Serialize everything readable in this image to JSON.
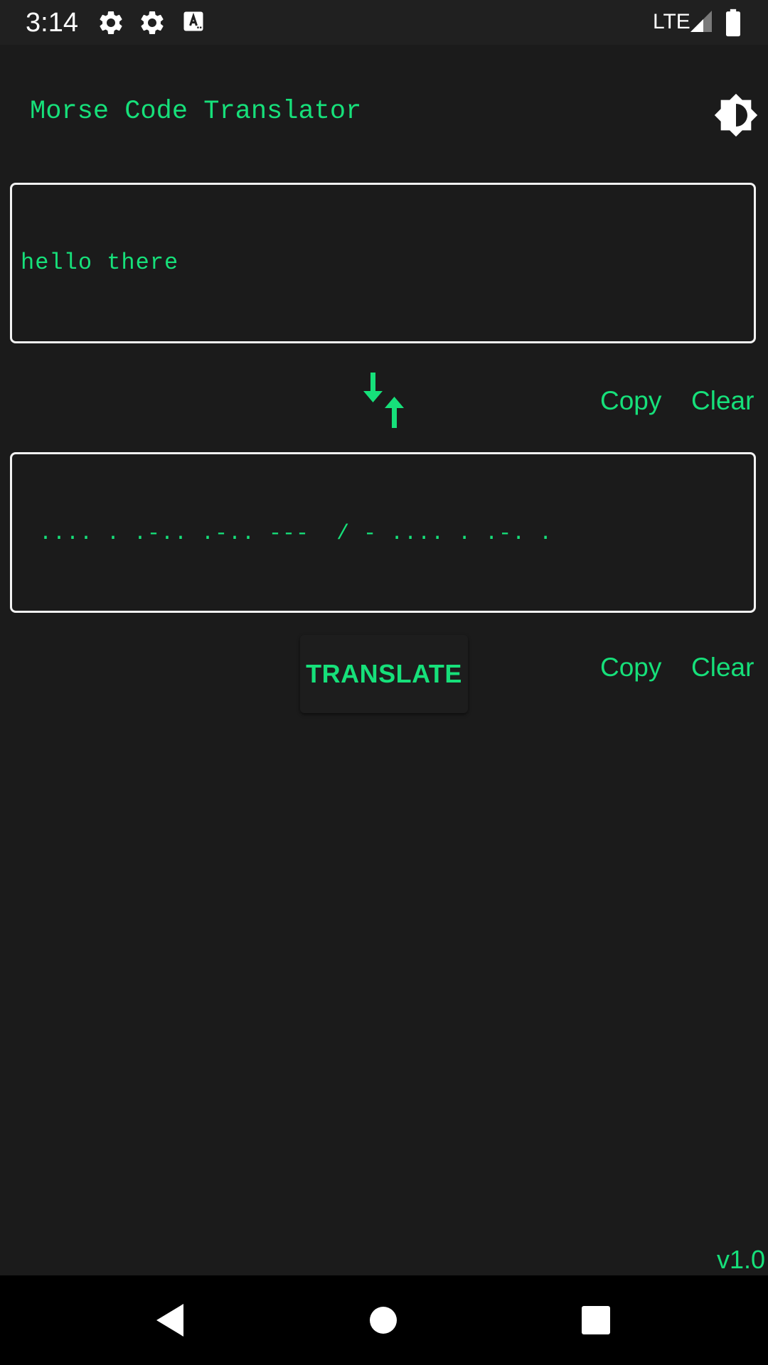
{
  "status_bar": {
    "time": "3:14",
    "network": "LTE",
    "icons": [
      "settings-icon",
      "settings-icon",
      "text-recognition-icon",
      "signal-icon",
      "battery-icon"
    ]
  },
  "header": {
    "title": "Morse Code Translator",
    "theme_icon": "brightness-contrast-icon"
  },
  "input_box": {
    "value": "hello there"
  },
  "input_actions": {
    "copy_label": "Copy",
    "clear_label": "Clear",
    "swap_icon": "swap-vertical-icon"
  },
  "output_box": {
    "value": ".... . .-.. .-.. ---  / - .... . .-. ."
  },
  "output_actions": {
    "translate_label": "TRANSLATE",
    "copy_label": "Copy",
    "clear_label": "Clear"
  },
  "footer": {
    "version": "v1.0"
  },
  "nav_bar": {
    "icons": [
      "back-icon",
      "home-icon",
      "recents-icon"
    ]
  },
  "colors": {
    "accent": "#16e07a",
    "background": "#1b1b1b",
    "status_bar": "#202020",
    "nav_bar": "#000000",
    "border": "#f2f2f2"
  }
}
